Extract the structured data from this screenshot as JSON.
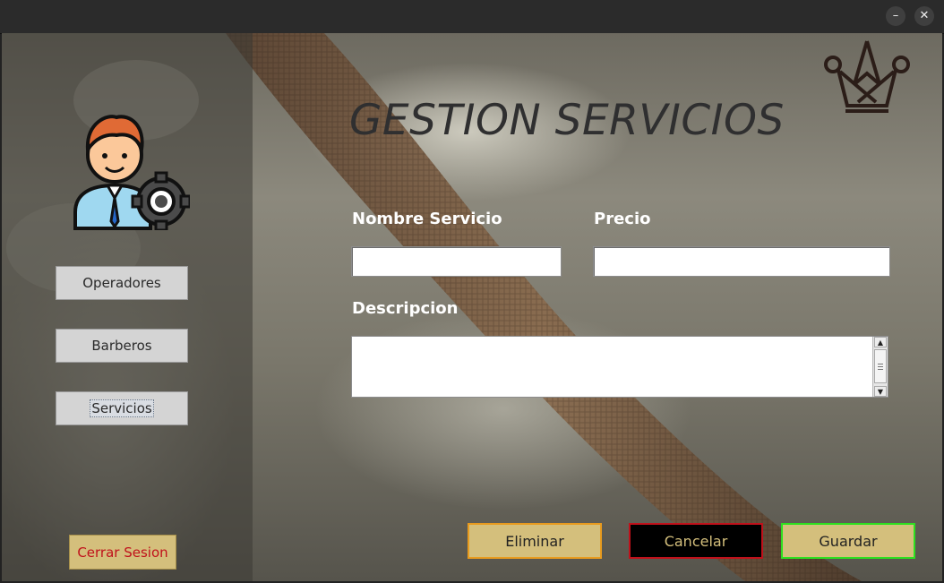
{
  "window": {
    "minimize_symbol": "–",
    "close_symbol": "✕"
  },
  "sidebar": {
    "avatar_icon": "user-gear-icon",
    "nav": [
      {
        "label": "Operadores",
        "active": false
      },
      {
        "label": "Barberos",
        "active": false
      },
      {
        "label": "Servicios",
        "active": true
      }
    ],
    "logout_label": "Cerrar Sesion"
  },
  "header": {
    "title": "GESTION SERVICIOS",
    "logo_icon": "crown-scissors-logo"
  },
  "form": {
    "nombre_label": "Nombre Servicio",
    "nombre_value": "",
    "precio_label": "Precio",
    "precio_value": "",
    "descripcion_label": "Descripcion",
    "descripcion_value": ""
  },
  "actions": {
    "eliminar_label": "Eliminar",
    "cancelar_label": "Cancelar",
    "guardar_label": "Guardar"
  },
  "colors": {
    "eliminar_bg": "#d4bf7c",
    "eliminar_border": "#e89b1e",
    "cancelar_bg": "#000000",
    "cancelar_border": "#c0111b",
    "cancelar_text": "#d4bf7c",
    "guardar_bg": "#d4bf7c",
    "guardar_border": "#2ee01f",
    "logout_text": "#c0111b"
  }
}
